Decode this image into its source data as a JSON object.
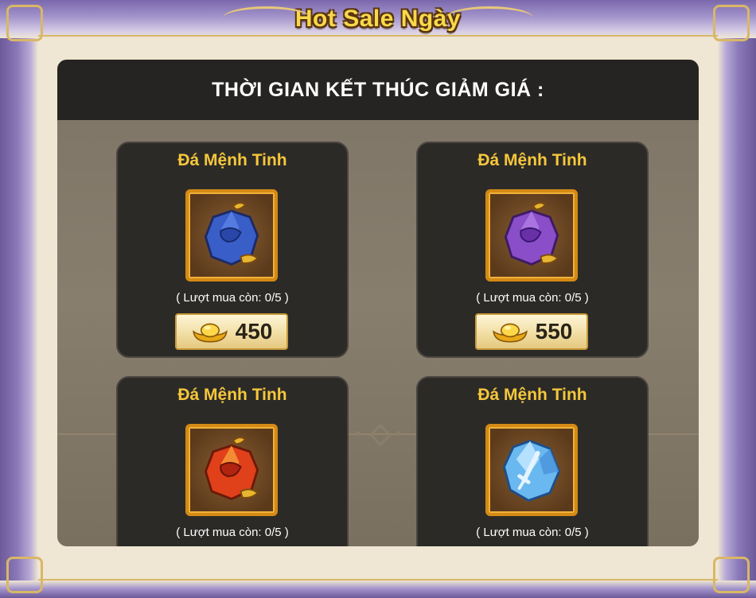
{
  "window": {
    "title": "Hot Sale Ngày"
  },
  "panel": {
    "header": "THỜI GIAN KẾT THÚC GIẢM GIÁ :"
  },
  "items": [
    {
      "name": "Đá Mệnh Tinh",
      "limit": "( Lượt mua còn: 0/5 )",
      "price": "450",
      "gem_color": "blue",
      "icon": "blue-gem-pouch-icon"
    },
    {
      "name": "Đá Mệnh Tinh",
      "limit": "( Lượt mua còn: 0/5 )",
      "price": "550",
      "gem_color": "purple",
      "icon": "purple-gem-pouch-icon"
    },
    {
      "name": "Đá Mệnh Tinh",
      "limit": "( Lượt mua còn: 0/5 )",
      "gem_color": "red",
      "icon": "red-gem-pouch-icon"
    },
    {
      "name": "Đá Mệnh Tinh",
      "limit": "( Lượt mua còn: 0/5 )",
      "gem_color": "light-blue",
      "icon": "ice-crystal-sword-icon"
    }
  ],
  "currency_icon": "gold-ingot-icon",
  "colors": {
    "title": "#f7d94a",
    "item_name": "#f5c73c",
    "frame": "#8a79b8",
    "card": "#2c2a27",
    "icon_border": "#d48a14"
  }
}
